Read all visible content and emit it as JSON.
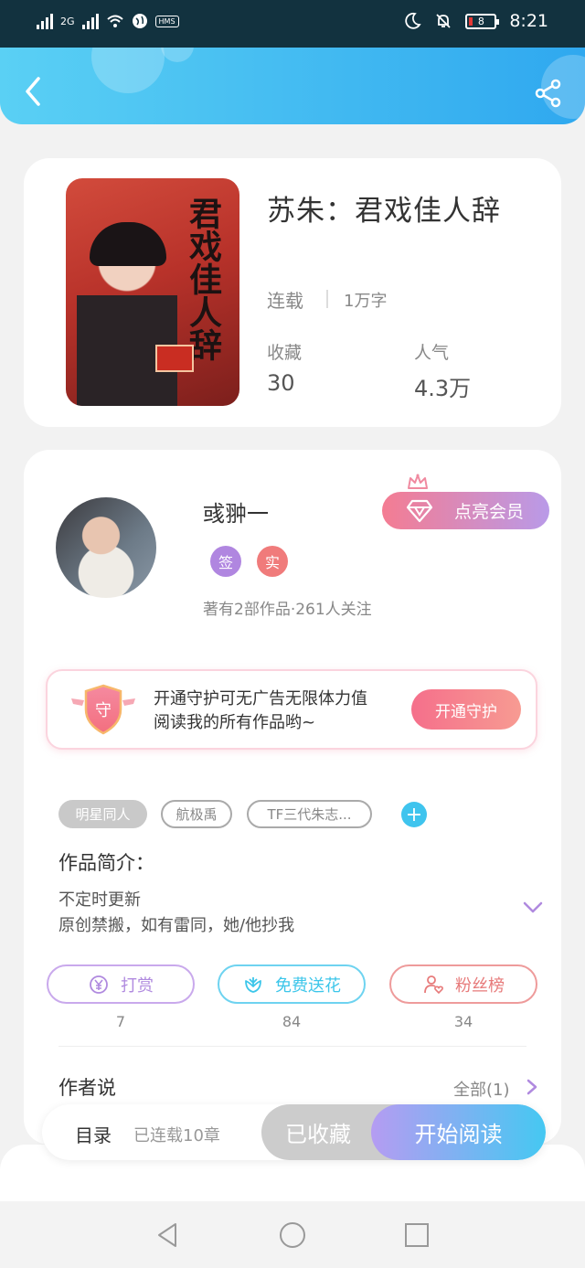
{
  "status_bar": {
    "network": "2G",
    "chip": "HMS",
    "battery": "8",
    "time": "8:21",
    "icons": [
      "signal-icon",
      "wifi-icon",
      "globe-icon",
      "moon-icon",
      "bell-off-icon",
      "battery-icon"
    ]
  },
  "header": {
    "back_icon": "back-icon",
    "share_icon": "share-icon"
  },
  "book": {
    "title": "苏朱：君戏佳人辞",
    "cover_title": "君戏佳人辞",
    "status": "连载",
    "word_count": "1万字",
    "stats": [
      {
        "label": "收藏",
        "value": "30"
      },
      {
        "label": "人气",
        "value": "4.3万"
      }
    ]
  },
  "author": {
    "name": "彧翀一",
    "badges": [
      "签",
      "实"
    ],
    "meta": "著有2部作品·261人关注",
    "vip_button": "点亮会员"
  },
  "guard": {
    "icon_text": "守",
    "line1": "开通守护可无广告无限体力值",
    "line2": "阅读我的所有作品哟~",
    "button": "开通守护"
  },
  "tags": [
    "明星同人",
    "航极禹",
    "TF三代朱志..."
  ],
  "intro": {
    "title": "作品简介：",
    "lines": [
      "不定时更新",
      "原创禁搬，如有雷同，她/他抄我"
    ]
  },
  "actions": [
    {
      "label": "打赏",
      "count": "7",
      "color": "#b08adf",
      "icon": "yen-icon"
    },
    {
      "label": "免费送花",
      "count": "84",
      "color": "#3cc6ea",
      "icon": "flower-icon"
    },
    {
      "label": "粉丝榜",
      "count": "34",
      "color": "#e77a7a",
      "icon": "fan-icon"
    }
  ],
  "author_says": {
    "title": "作者说",
    "all": "全部(1)"
  },
  "bottom_bar": {
    "toc": "目录",
    "chapters": "已连载10章",
    "collected": "已收藏",
    "read": "开始阅读"
  },
  "nav": [
    "back-triangle-icon",
    "home-circle-icon",
    "recents-square-icon"
  ]
}
